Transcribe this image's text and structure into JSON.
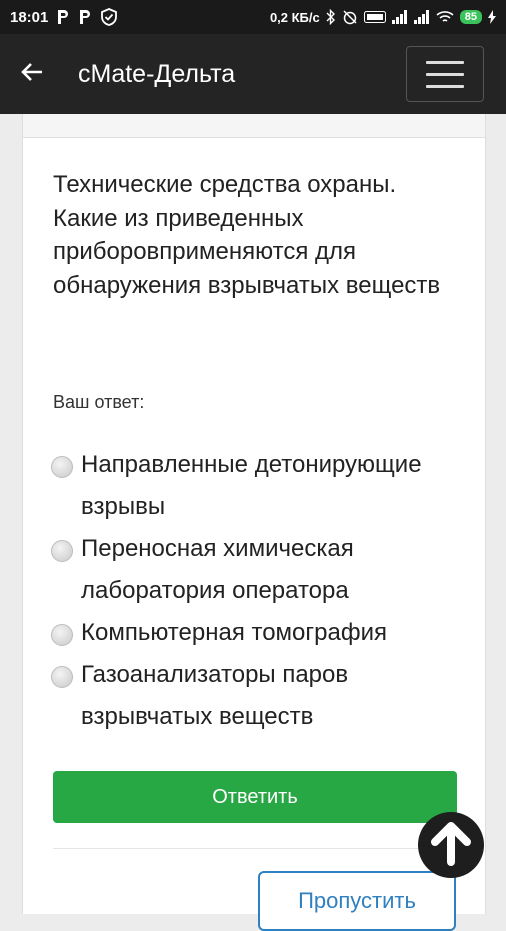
{
  "status_bar": {
    "time": "18:01",
    "network_speed": "0,2 КБ/с",
    "battery": "85"
  },
  "app_bar": {
    "title": "сMate-Дельта"
  },
  "quiz": {
    "question": "Технические средства охраны. Какие из приведенных приборовприменяются для обнаружения взрывчатых веществ",
    "answer_label": "Ваш ответ:",
    "options": [
      "Направленные детонирующие взрывы",
      "Переносная химическая лаборатория оператора",
      "Компьютерная томография",
      "Газоанализаторы паров взрывчатых веществ"
    ],
    "submit_label": "Ответить",
    "skip_label": "Пропустить"
  },
  "colors": {
    "app_bar": "#242424",
    "submit": "#28a745",
    "skip": "#2f80c0"
  }
}
